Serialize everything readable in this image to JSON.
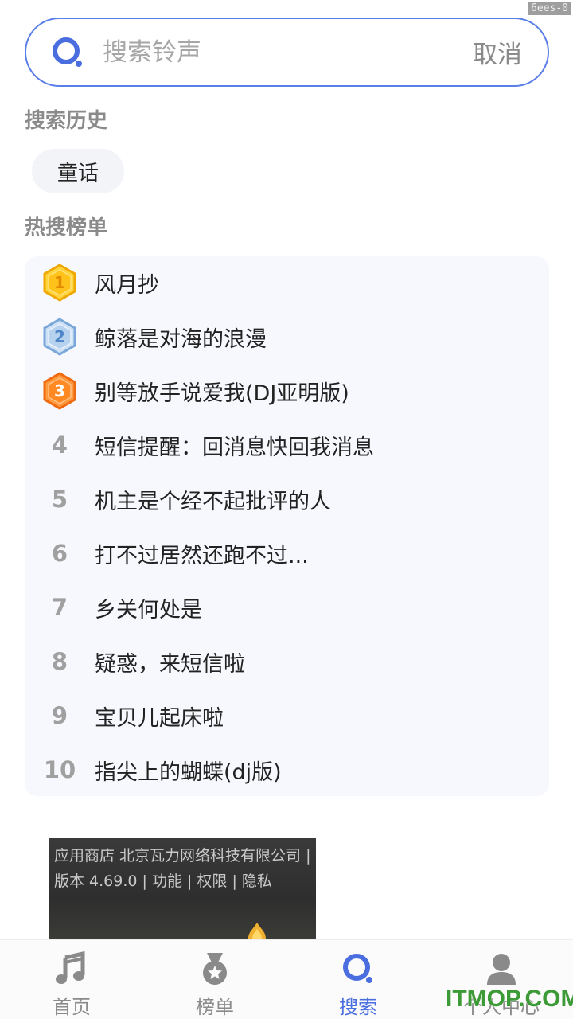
{
  "debug_tag": "6ees-0",
  "search": {
    "placeholder": "搜索铃声",
    "cancel_label": "取消"
  },
  "history": {
    "title": "搜索历史",
    "items": [
      "童话"
    ]
  },
  "hot": {
    "title": "热搜榜单",
    "items": [
      {
        "rank": "1",
        "name": "风月抄"
      },
      {
        "rank": "2",
        "name": "鲸落是对海的浪漫"
      },
      {
        "rank": "3",
        "name": "别等放手说爱我(DJ亚明版)"
      },
      {
        "rank": "4",
        "name": "短信提醒：回消息快回我消息"
      },
      {
        "rank": "5",
        "name": "机主是个经不起批评的人"
      },
      {
        "rank": "6",
        "name": "打不过居然还跑不过..."
      },
      {
        "rank": "7",
        "name": "乡关何处是"
      },
      {
        "rank": "8",
        "name": "疑惑，来短信啦"
      },
      {
        "rank": "9",
        "name": "宝贝儿起床啦"
      },
      {
        "rank": "10",
        "name": "指尖上的蝴蝶(dj版)"
      }
    ]
  },
  "ad": {
    "text": "应用商店 北京瓦力网络科技有限公司 | 版本 4.69.0 | 功能 | 权限 | 隐私"
  },
  "tabs": [
    {
      "label": "首页",
      "icon": "music-note-icon"
    },
    {
      "label": "榜单",
      "icon": "medal-icon"
    },
    {
      "label": "搜索",
      "icon": "search-icon",
      "active": true
    },
    {
      "label": "个人中心",
      "icon": "person-icon"
    }
  ],
  "watermark": "ITMOP.COM",
  "colors": {
    "accent": "#4a6ee0",
    "gold": "#f5b400",
    "silver": "#6fa0d8",
    "bronze": "#f57c1f"
  }
}
